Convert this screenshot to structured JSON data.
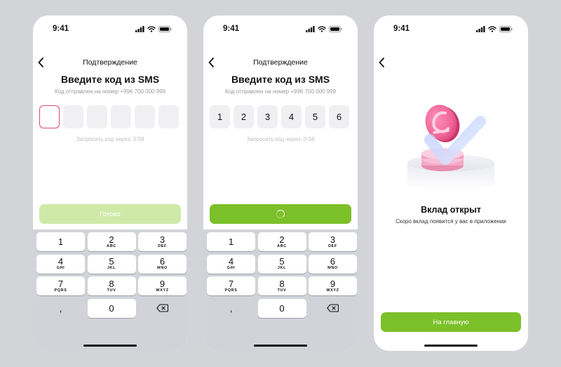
{
  "status_time": "9:41",
  "screens": {
    "code_empty": {
      "nav_title": "Подтверждение",
      "heading": "Введите код из SMS",
      "subtitle": "Код отправлен на номер +996 700 000 999",
      "code": [
        "",
        "",
        "",
        "",
        "",
        ""
      ],
      "resend": "Запросить код через: 0:58",
      "button_label": "Готово"
    },
    "code_filled": {
      "nav_title": "Подтверждение",
      "heading": "Введите код из SMS",
      "subtitle": "Код отправлен на номер +996 700 000 999",
      "code": [
        "1",
        "2",
        "3",
        "4",
        "5",
        "6"
      ],
      "resend": "Запросить код через: 0:58"
    },
    "success": {
      "title": "Вклад открыт",
      "subtitle": "Скоро вклад появится у вас в приложении",
      "button_label": "На главную"
    }
  },
  "keypad": [
    {
      "digit": "1",
      "letters": ""
    },
    {
      "digit": "2",
      "letters": "ABC"
    },
    {
      "digit": "3",
      "letters": "DEF"
    },
    {
      "digit": "4",
      "letters": "GHI"
    },
    {
      "digit": "5",
      "letters": "JKL"
    },
    {
      "digit": "6",
      "letters": "MNO"
    },
    {
      "digit": "7",
      "letters": "PQRS"
    },
    {
      "digit": "8",
      "letters": "TUV"
    },
    {
      "digit": "9",
      "letters": "WXYZ"
    }
  ],
  "keypad_bottom": {
    "left": ",",
    "zero": "0"
  },
  "icons": {
    "back": "chevron-left-icon",
    "backspace": "backspace-icon",
    "signal": "signal-icon",
    "wifi": "wifi-icon",
    "battery": "battery-icon"
  },
  "colors": {
    "accent_green": "#7cc02a",
    "disabled_green": "#cfeaa8",
    "focus_pink": "#e0457b",
    "coin_pink": "#f06698"
  }
}
